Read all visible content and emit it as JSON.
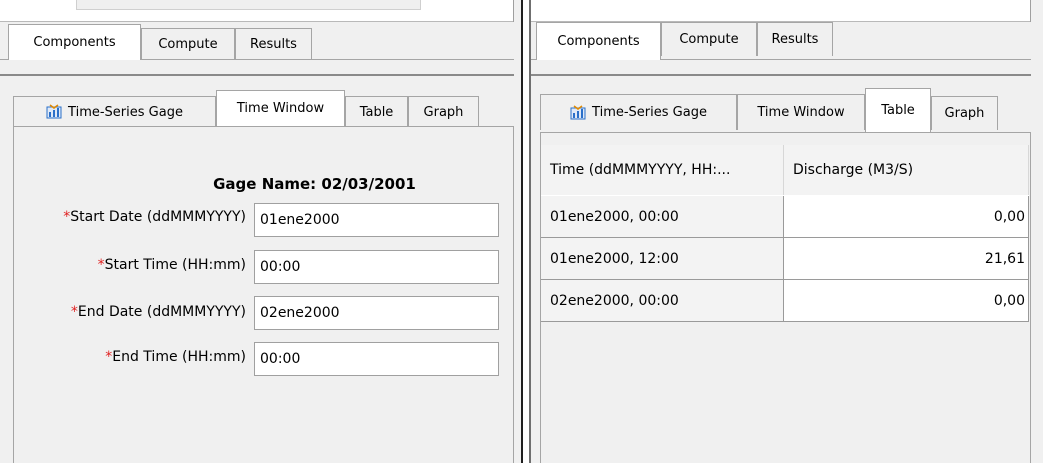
{
  "left": {
    "top_tabs": [
      "Components",
      "Compute",
      "Results"
    ],
    "sub_tabs": {
      "gage": "Time-Series Gage",
      "window": "Time Window",
      "table": "Table",
      "graph": "Graph"
    },
    "gage_name": "Gage Name: 02/03/2001",
    "required_marker": "*",
    "fields": [
      {
        "label": "Start Date (ddMMMYYYY)",
        "value": "01ene2000"
      },
      {
        "label": "Start Time (HH:mm)",
        "value": "00:00"
      },
      {
        "label": "End Date (ddMMMYYYY)",
        "value": "02ene2000"
      },
      {
        "label": "End Time (HH:mm)",
        "value": "00:00"
      }
    ]
  },
  "right": {
    "top_tabs": [
      "Components",
      "Compute",
      "Results"
    ],
    "sub_tabs": {
      "gage": "Time-Series Gage",
      "window": "Time Window",
      "table": "Table",
      "graph": "Graph"
    },
    "table": {
      "columns": [
        "Time (ddMMMYYYY, HH:...",
        "Discharge (M3/S)"
      ],
      "rows": [
        [
          "01ene2000, 00:00",
          "0,00"
        ],
        [
          "01ene2000, 12:00",
          "21,61"
        ],
        [
          "02ene2000, 00:00",
          "0,00"
        ]
      ]
    }
  },
  "icons": {
    "gage": "gage-icon"
  },
  "colors": {
    "required": "#e02020",
    "icon_blue": "#2a6fc9"
  }
}
